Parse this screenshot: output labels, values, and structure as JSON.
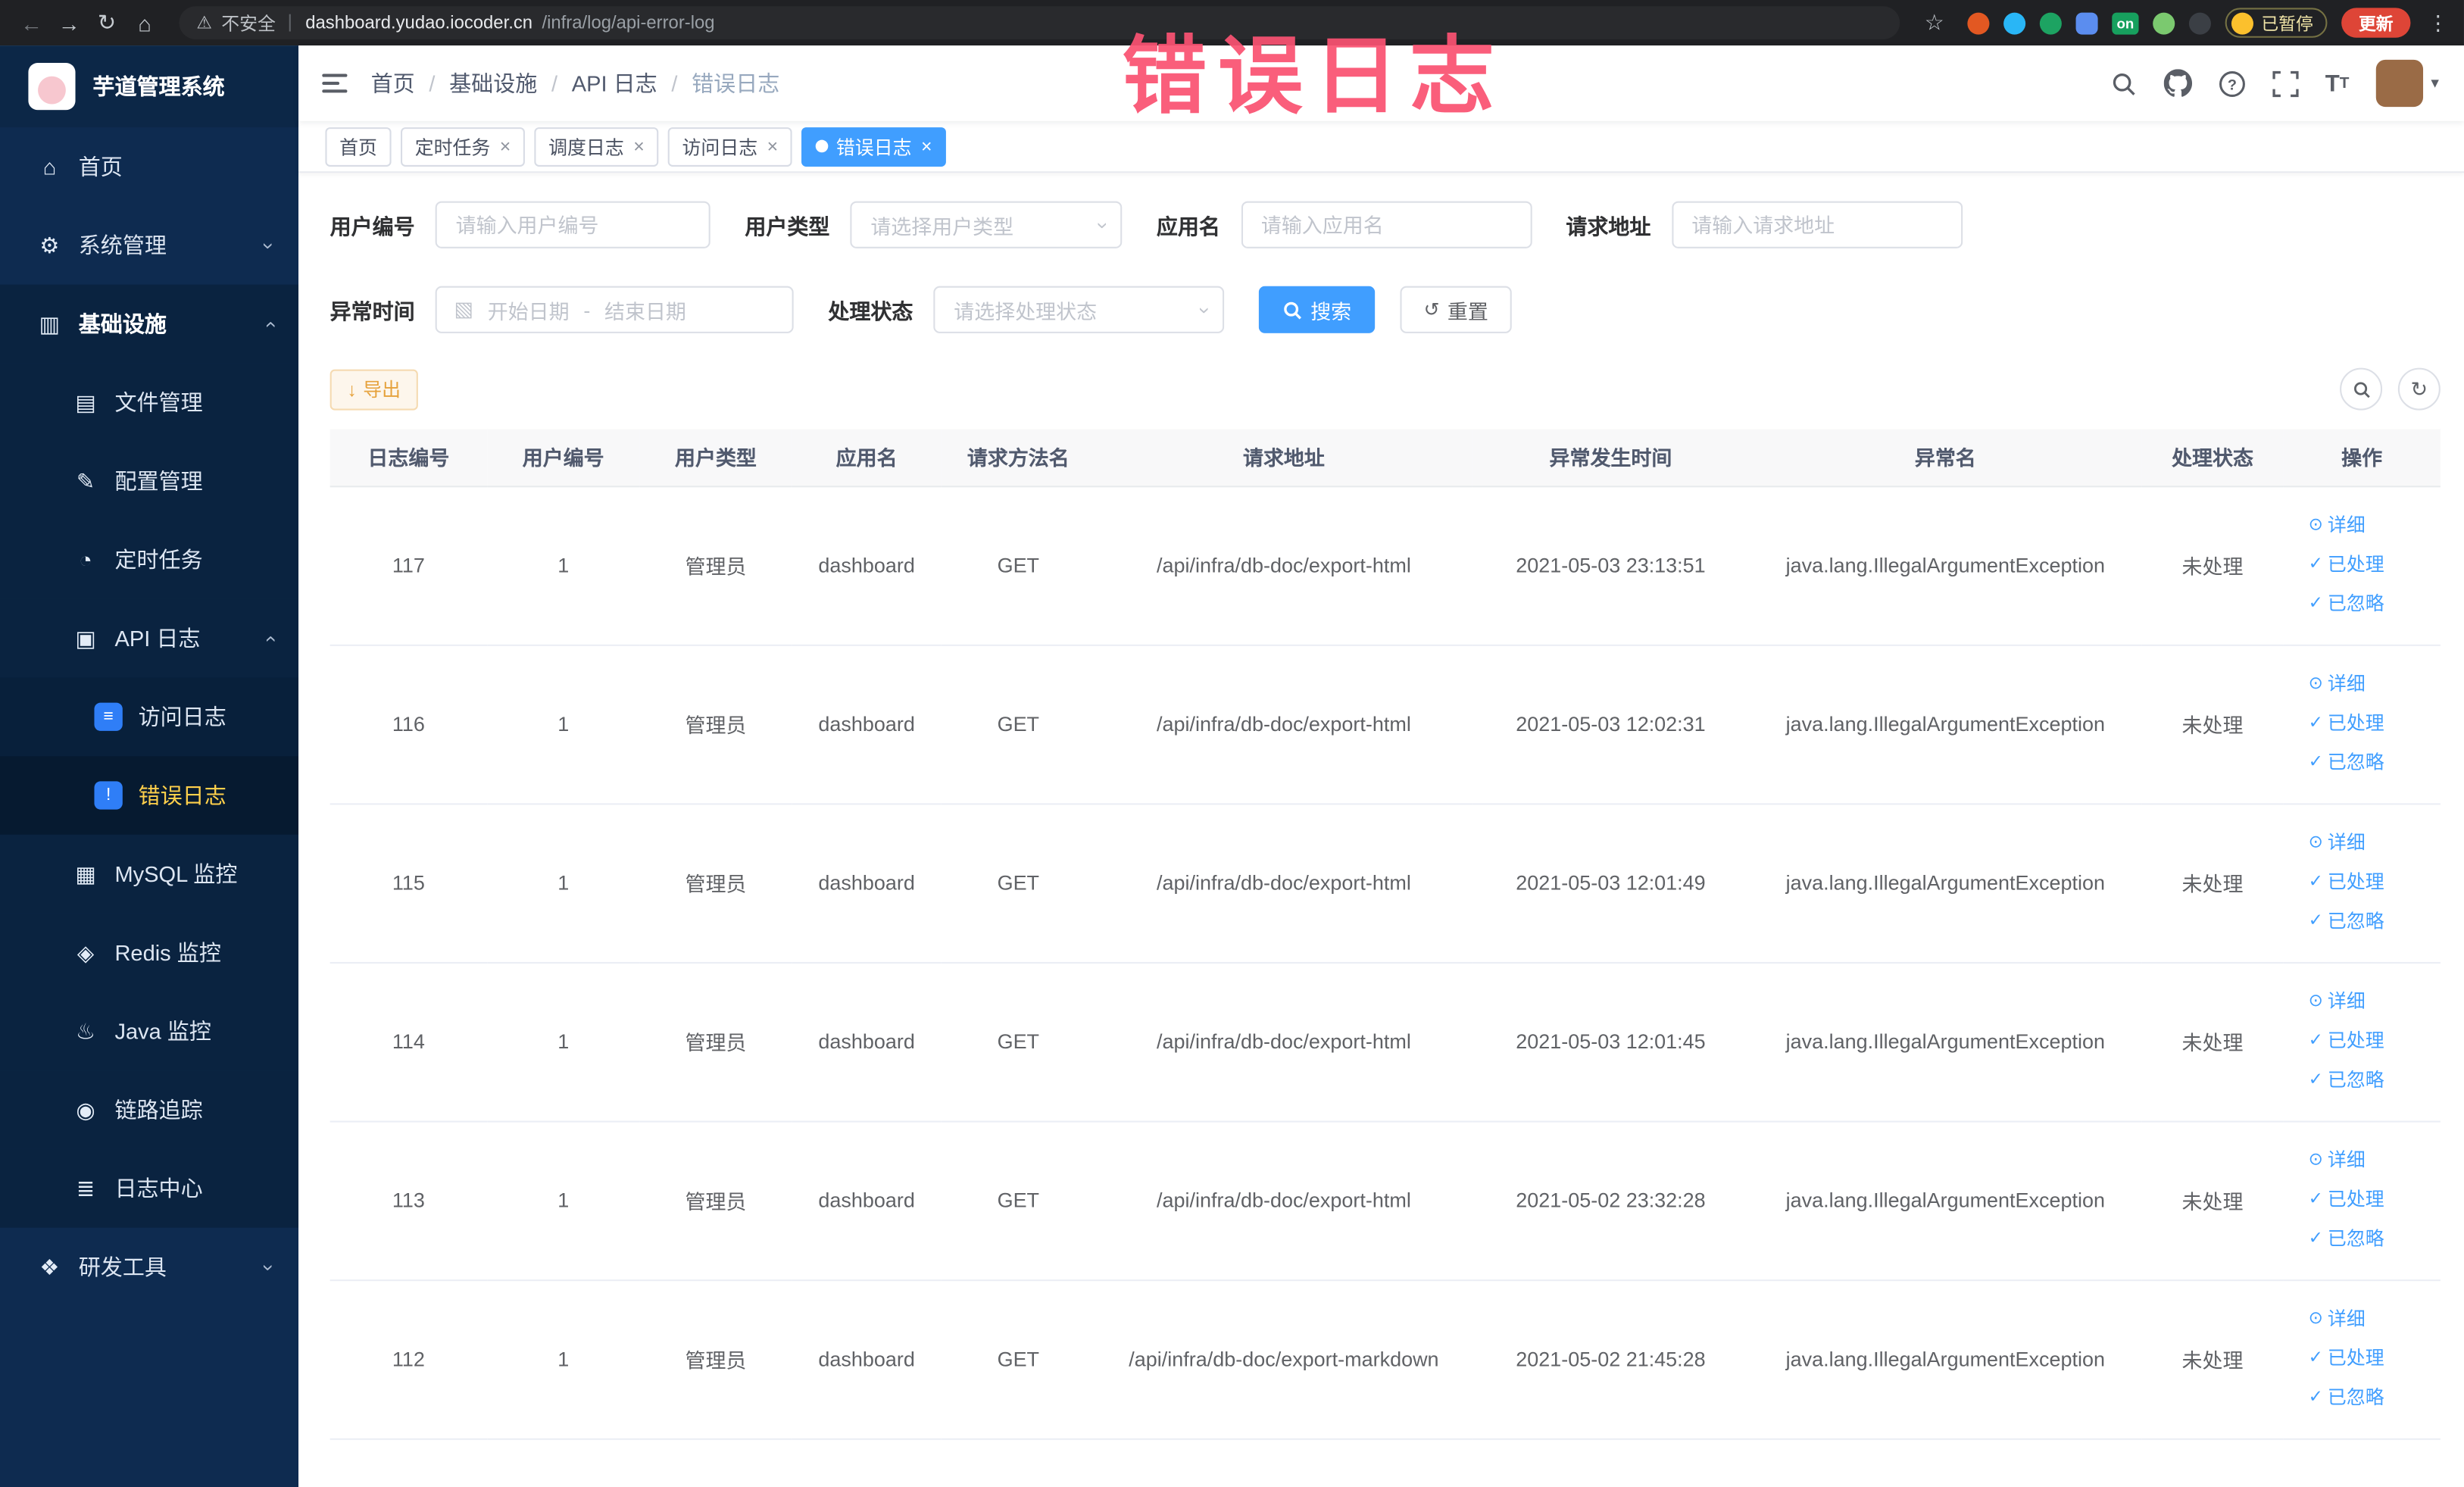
{
  "browser": {
    "security_label": "不安全",
    "url_domain": "dashboard.yudao.iocoder.cn",
    "url_path": "/infra/log/api-error-log",
    "ext_on": "on",
    "paused_label": "已暂停",
    "update_label": "更新"
  },
  "annotation": {
    "text": "错误日志"
  },
  "sidebar": {
    "logo_title": "芋道管理系统",
    "items": [
      {
        "label": "首页"
      },
      {
        "label": "系统管理"
      },
      {
        "label": "基础设施"
      },
      {
        "label": "文件管理"
      },
      {
        "label": "配置管理"
      },
      {
        "label": "定时任务"
      },
      {
        "label": "API 日志"
      },
      {
        "label": "访问日志"
      },
      {
        "label": "错误日志"
      },
      {
        "label": "MySQL 监控"
      },
      {
        "label": "Redis 监控"
      },
      {
        "label": "Java 监控"
      },
      {
        "label": "链路追踪"
      },
      {
        "label": "日志中心"
      },
      {
        "label": "研发工具"
      }
    ]
  },
  "nav": {
    "breadcrumb": [
      "首页",
      "基础设施",
      "API 日志",
      "错误日志"
    ],
    "separator": "/"
  },
  "tabs": [
    {
      "label": "首页"
    },
    {
      "label": "定时任务"
    },
    {
      "label": "调度日志"
    },
    {
      "label": "访问日志"
    },
    {
      "label": "错误日志"
    }
  ],
  "filters": {
    "user_id_label": "用户编号",
    "user_id_placeholder": "请输入用户编号",
    "user_type_label": "用户类型",
    "user_type_placeholder": "请选择用户类型",
    "app_name_label": "应用名",
    "app_name_placeholder": "请输入应用名",
    "request_url_label": "请求地址",
    "request_url_placeholder": "请输入请求地址",
    "exception_time_label": "异常时间",
    "start_date_placeholder": "开始日期",
    "end_date_placeholder": "结束日期",
    "date_separator": "-",
    "process_status_label": "处理状态",
    "process_status_placeholder": "请选择处理状态",
    "search_button": "搜索",
    "reset_button": "重置"
  },
  "toolbar": {
    "export_label": "导出"
  },
  "table": {
    "columns": [
      "日志编号",
      "用户编号",
      "用户类型",
      "应用名",
      "请求方法名",
      "请求地址",
      "异常发生时间",
      "异常名",
      "处理状态",
      "操作"
    ],
    "actions": {
      "detail": "详细",
      "processed": "已处理",
      "ignored": "已忽略"
    },
    "rows": [
      {
        "id": "117",
        "user_id": "1",
        "user_type": "管理员",
        "app": "dashboard",
        "method": "GET",
        "url": "/api/infra/db-doc/export-html",
        "time": "2021-05-03 23:13:51",
        "exception": "java.lang.IllegalArgumentException",
        "status": "未处理"
      },
      {
        "id": "116",
        "user_id": "1",
        "user_type": "管理员",
        "app": "dashboard",
        "method": "GET",
        "url": "/api/infra/db-doc/export-html",
        "time": "2021-05-03 12:02:31",
        "exception": "java.lang.IllegalArgumentException",
        "status": "未处理"
      },
      {
        "id": "115",
        "user_id": "1",
        "user_type": "管理员",
        "app": "dashboard",
        "method": "GET",
        "url": "/api/infra/db-doc/export-html",
        "time": "2021-05-03 12:01:49",
        "exception": "java.lang.IllegalArgumentException",
        "status": "未处理"
      },
      {
        "id": "114",
        "user_id": "1",
        "user_type": "管理员",
        "app": "dashboard",
        "method": "GET",
        "url": "/api/infra/db-doc/export-html",
        "time": "2021-05-03 12:01:45",
        "exception": "java.lang.IllegalArgumentException",
        "status": "未处理"
      },
      {
        "id": "113",
        "user_id": "1",
        "user_type": "管理员",
        "app": "dashboard",
        "method": "GET",
        "url": "/api/infra/db-doc/export-html",
        "time": "2021-05-02 23:32:28",
        "exception": "java.lang.IllegalArgumentException",
        "status": "未处理"
      },
      {
        "id": "112",
        "user_id": "1",
        "user_type": "管理员",
        "app": "dashboard",
        "method": "GET",
        "url": "/api/infra/db-doc/export-markdown",
        "time": "2021-05-02 21:45:28",
        "exception": "java.lang.IllegalArgumentException",
        "status": "未处理"
      }
    ]
  },
  "colors": {
    "primary": "#409eff",
    "sidebar_bg": "#0e2b50",
    "sidebar_active_text": "#ffd04b",
    "warning_text": "#e6a23c",
    "annotation": "#fa5272",
    "update_button": "#de4537"
  }
}
